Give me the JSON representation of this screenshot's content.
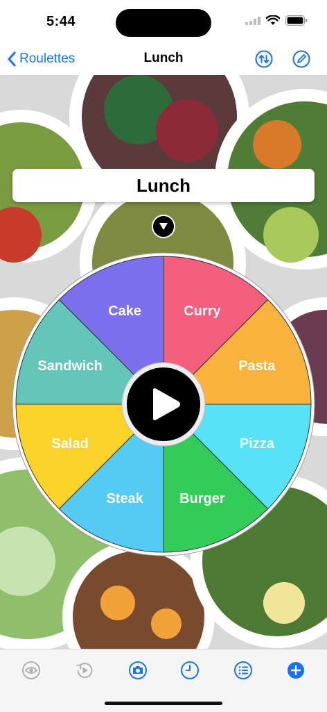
{
  "status": {
    "time": "5:44"
  },
  "nav": {
    "back_label": "Roulettes",
    "title": "Lunch"
  },
  "roulette": {
    "title": "Lunch",
    "segments": [
      {
        "label": "Curry",
        "color": "#F45F7E"
      },
      {
        "label": "Pasta",
        "color": "#FBB33D"
      },
      {
        "label": "Pizza",
        "color": "#56E3F8"
      },
      {
        "label": "Burger",
        "color": "#33CB5A"
      },
      {
        "label": "Steak",
        "color": "#55CBF4"
      },
      {
        "label": "Salad",
        "color": "#FDD22A"
      },
      {
        "label": "Sandwich",
        "color": "#63C6B9"
      },
      {
        "label": "Cake",
        "color": "#7C70EE"
      }
    ]
  },
  "toolbar": {
    "items": [
      {
        "icon": "eye-icon",
        "enabled": false
      },
      {
        "icon": "replay-icon",
        "enabled": false
      },
      {
        "icon": "camera-icon",
        "enabled": true
      },
      {
        "icon": "clock-icon",
        "enabled": true
      },
      {
        "icon": "list-icon",
        "enabled": true
      },
      {
        "icon": "add-icon",
        "enabled": true
      }
    ]
  },
  "colors": {
    "accent": "#1a73e8",
    "disabled": "#b0b0b0"
  }
}
